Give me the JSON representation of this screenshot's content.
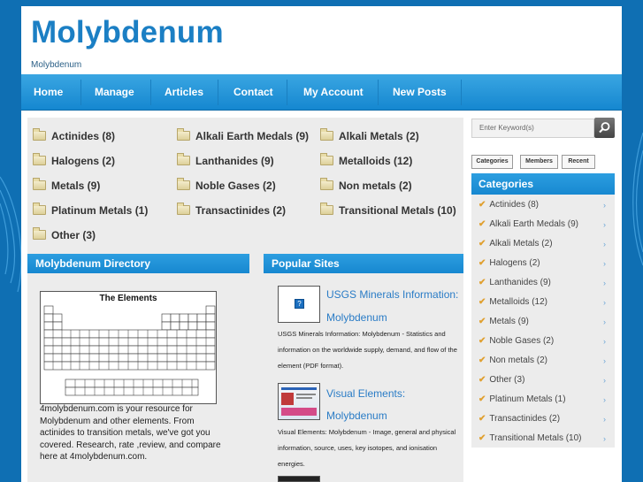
{
  "site": {
    "title": "Molybdenum",
    "tagline": "Molybdenum"
  },
  "nav": [
    "Home",
    "Manage",
    "Articles",
    "Contact",
    "My Account",
    "New Posts"
  ],
  "categories": [
    {
      "label": "Actinides (8)"
    },
    {
      "label": "Alkali Earth Medals (9)"
    },
    {
      "label": "Alkali Metals (2)"
    },
    {
      "label": "Halogens (2)"
    },
    {
      "label": "Lanthanides (9)"
    },
    {
      "label": "Metalloids (12)"
    },
    {
      "label": "Metals (9)"
    },
    {
      "label": "Noble Gases (2)"
    },
    {
      "label": "Non metals (2)"
    },
    {
      "label": "Platinum Metals (1)"
    },
    {
      "label": "Transactinides (2)"
    },
    {
      "label": "Transitional Metals (10)"
    },
    {
      "label": "Other (3)"
    }
  ],
  "directory": {
    "heading": "Molybdenum Directory",
    "image_title": "The Elements",
    "text": "4molybdenum.com is your resource for Molybdenum and other elements. From actinides to transition metals, we've got you covered. Research, rate ,review, and compare here at 4molybdenum.com."
  },
  "popular": {
    "heading": "Popular Sites",
    "sites": [
      {
        "link_line1": "USGS Minerals Information:",
        "link_line2": "Molybdenum",
        "description": "USGS Minerals Information: Molybdenum - Statistics and information on the worldwide supply, demand, and flow of the element (PDF format)."
      },
      {
        "link_line1": "Visual Elements:",
        "link_line2": "Molybdenum",
        "description": "Visual Elements: Molybdenum - Image, general and physical information, source, uses, key isotopes, and ionisation energies."
      }
    ]
  },
  "sidebar": {
    "search_placeholder": "Enter Keyword(s)",
    "tabs": [
      "Categories",
      "Members",
      "Recent"
    ],
    "heading": "Categories",
    "items": [
      "Actinides (8)",
      "Alkali Earth Medals (9)",
      "Alkali Metals (2)",
      "Halogens (2)",
      "Lanthanides (9)",
      "Metalloids (12)",
      "Metals (9)",
      "Noble Gases (2)",
      "Non metals (2)",
      "Other (3)",
      "Platinum Metals (1)",
      "Transactinides (2)",
      "Transitional Metals (10)"
    ]
  },
  "colors": {
    "brand_blue": "#1b7fc4",
    "nav_blue": "#1f93d8",
    "link": "#2a7cc6",
    "check": "#e0a030"
  }
}
